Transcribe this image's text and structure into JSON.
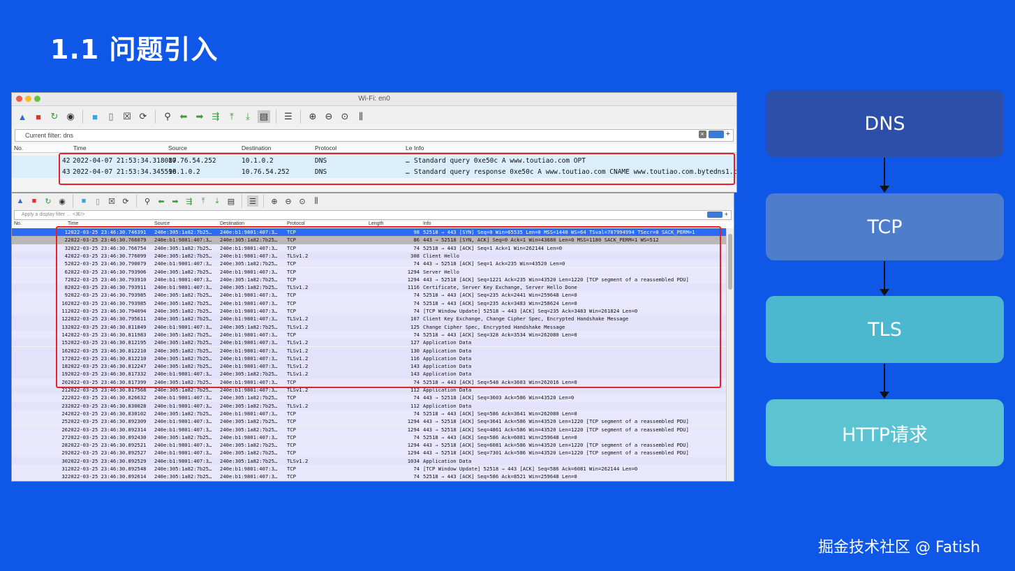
{
  "slide": {
    "title": "1.1 问题引入"
  },
  "top_window": {
    "title": "Wi-Fi: en0",
    "filter_label": "Current filter: dns",
    "columns": [
      "No.",
      "Time",
      "Source",
      "Destination",
      "Protocol",
      "Le",
      "Info"
    ],
    "rows": [
      {
        "no": "42",
        "time": "2022-04-07 21:53:34.318087",
        "source": "10.76.54.252",
        "destination": "10.1.0.2",
        "protocol": "DNS",
        "len": "…",
        "info": "Standard query 0xe50c A www.toutiao.com OPT"
      },
      {
        "no": "43",
        "time": "2022-04-07 21:53:34.345596",
        "source": "10.1.0.2",
        "destination": "10.76.54.252",
        "protocol": "DNS",
        "len": "…",
        "info": "Standard query response 0xe50c A www.toutiao.com CNAME www.toutiao.com.bytedns1.com CNAME ww"
      }
    ]
  },
  "bottom_window": {
    "filter_placeholder": "Apply a display filter … <⌘/>",
    "columns": [
      "No.",
      "Time",
      "Source",
      "Destination",
      "Protocol",
      "Length",
      "Info"
    ],
    "rows": [
      {
        "no": "1",
        "time": "2022-03-25 23:46:30.746391",
        "src": "240e:305:1a82:7b25…",
        "dst": "240e:b1:9801:407:3…",
        "proto": "TCP",
        "len": "98",
        "info": "52518 → 443 [SYN] Seq=0 Win=65535 Len=0 MSS=1440 WS=64 TSval=787994994 TSecr=0 SACK_PERM=1"
      },
      {
        "no": "2",
        "time": "2022-03-25 23:46:30.766079",
        "src": "240e:b1:9801:407:3…",
        "dst": "240e:305:1a82:7b25…",
        "proto": "TCP",
        "len": "86",
        "info": "443 → 52518 [SYN, ACK] Seq=0 Ack=1 Win=43680 Len=0 MSS=1180 SACK_PERM=1 WS=512"
      },
      {
        "no": "3",
        "time": "2022-03-25 23:46:30.766754",
        "src": "240e:305:1a82:7b25…",
        "dst": "240e:b1:9801:407:3…",
        "proto": "TCP",
        "len": "74",
        "info": "52518 → 443 [ACK] Seq=1 Ack=1 Win=262144 Len=0"
      },
      {
        "no": "4",
        "time": "2022-03-25 23:46:30.776099",
        "src": "240e:305:1a82:7b25…",
        "dst": "240e:b1:9801:407:3…",
        "proto": "TLSv1.2",
        "len": "308",
        "info": "Client Hello"
      },
      {
        "no": "5",
        "time": "2022-03-25 23:46:30.790079",
        "src": "240e:b1:9801:407:3…",
        "dst": "240e:305:1a82:7b25…",
        "proto": "TCP",
        "len": "74",
        "info": "443 → 52518 [ACK] Seq=1 Ack=235 Win=43520 Len=0"
      },
      {
        "no": "6",
        "time": "2022-03-25 23:46:30.793906",
        "src": "240e:305:1a82:7b25…",
        "dst": "240e:b1:9801:407:3…",
        "proto": "TCP",
        "len": "1294",
        "info": "Server Hello"
      },
      {
        "no": "7",
        "time": "2022-03-25 23:46:30.793910",
        "src": "240e:b1:9801:407:3…",
        "dst": "240e:305:1a82:7b25…",
        "proto": "TCP",
        "len": "1294",
        "info": "443 → 52518 [ACK] Seq=1221 Ack=235 Win=43520 Len=1220 [TCP segment of a reassembled PDU]"
      },
      {
        "no": "8",
        "time": "2022-03-25 23:46:30.793911",
        "src": "240e:b1:9801:407:3…",
        "dst": "240e:305:1a82:7b25…",
        "proto": "TLSv1.2",
        "len": "1116",
        "info": "Certificate, Server Key Exchange, Server Hello Done"
      },
      {
        "no": "9",
        "time": "2022-03-25 23:46:30.793985",
        "src": "240e:305:1a82:7b25…",
        "dst": "240e:b1:9801:407:3…",
        "proto": "TCP",
        "len": "74",
        "info": "52518 → 443 [ACK] Seq=235 Ack=2441 Win=259648 Len=0"
      },
      {
        "no": "10",
        "time": "2022-03-25 23:46:30.793985",
        "src": "240e:305:1a82:7b25…",
        "dst": "240e:b1:9801:407:3…",
        "proto": "TCP",
        "len": "74",
        "info": "52518 → 443 [ACK] Seq=235 Ack=3483 Win=258624 Len=0"
      },
      {
        "no": "11",
        "time": "2022-03-25 23:46:30.794094",
        "src": "240e:305:1a82:7b25…",
        "dst": "240e:b1:9801:407:3…",
        "proto": "TCP",
        "len": "74",
        "info": "[TCP Window Update] 52518 → 443 [ACK] Seq=235 Ack=3483 Win=261824 Len=0"
      },
      {
        "no": "12",
        "time": "2022-03-25 23:46:30.795611",
        "src": "240e:305:1a82:7b25…",
        "dst": "240e:b1:9801:407:3…",
        "proto": "TLSv1.2",
        "len": "167",
        "info": "Client Key Exchange, Change Cipher Spec, Encrypted Handshake Message"
      },
      {
        "no": "13",
        "time": "2022-03-25 23:46:30.811849",
        "src": "240e:b1:9801:407:3…",
        "dst": "240e:305:1a82:7b25…",
        "proto": "TLSv1.2",
        "len": "125",
        "info": "Change Cipher Spec, Encrypted Handshake Message"
      },
      {
        "no": "14",
        "time": "2022-03-25 23:46:30.811983",
        "src": "240e:305:1a82:7b25…",
        "dst": "240e:b1:9801:407:3…",
        "proto": "TCP",
        "len": "74",
        "info": "52518 → 443 [ACK] Seq=328 Ack=3534 Win=262080 Len=0"
      },
      {
        "no": "15",
        "time": "2022-03-25 23:46:30.812195",
        "src": "240e:305:1a82:7b25…",
        "dst": "240e:b1:9801:407:3…",
        "proto": "TLSv1.2",
        "len": "127",
        "info": "Application Data"
      },
      {
        "no": "16",
        "time": "2022-03-25 23:46:30.812210",
        "src": "240e:305:1a82:7b25…",
        "dst": "240e:b1:9801:407:3…",
        "proto": "TLSv1.2",
        "len": "130",
        "info": "Application Data"
      },
      {
        "no": "17",
        "time": "2022-03-25 23:46:30.812210",
        "src": "240e:305:1a82:7b25…",
        "dst": "240e:b1:9801:407:3…",
        "proto": "TLSv1.2",
        "len": "116",
        "info": "Application Data"
      },
      {
        "no": "18",
        "time": "2022-03-25 23:46:30.812247",
        "src": "240e:305:1a82:7b25…",
        "dst": "240e:b1:9801:407:3…",
        "proto": "TLSv1.2",
        "len": "143",
        "info": "Application Data"
      },
      {
        "no": "19",
        "time": "2022-03-25 23:46:30.817332",
        "src": "240e:b1:9801:407:3…",
        "dst": "240e:305:1a82:7b25…",
        "proto": "TLSv1.2",
        "len": "143",
        "info": "Application Data"
      },
      {
        "no": "20",
        "time": "2022-03-25 23:46:30.817399",
        "src": "240e:305:1a82:7b25…",
        "dst": "240e:b1:9801:407:3…",
        "proto": "TCP",
        "len": "74",
        "info": "52518 → 443 [ACK] Seq=548 Ack=3603 Win=262016 Len=0"
      },
      {
        "no": "21",
        "time": "2022-03-25 23:46:30.817568",
        "src": "240e:305:1a82:7b25…",
        "dst": "240e:b1:9801:407:3…",
        "proto": "TLSv1.2",
        "len": "112",
        "info": "Application Data"
      },
      {
        "no": "22",
        "time": "2022-03-25 23:46:30.826632",
        "src": "240e:b1:9801:407:3…",
        "dst": "240e:305:1a82:7b25…",
        "proto": "TCP",
        "len": "74",
        "info": "443 → 52518 [ACK] Seq=3603 Ack=586 Win=43520 Len=0"
      },
      {
        "no": "23",
        "time": "2022-03-25 23:46:30.830028",
        "src": "240e:b1:9801:407:3…",
        "dst": "240e:305:1a82:7b25…",
        "proto": "TLSv1.2",
        "len": "112",
        "info": "Application Data"
      },
      {
        "no": "24",
        "time": "2022-03-25 23:46:30.830102",
        "src": "240e:305:1a82:7b25…",
        "dst": "240e:b1:9801:407:3…",
        "proto": "TCP",
        "len": "74",
        "info": "52518 → 443 [ACK] Seq=586 Ack=3641 Win=262080 Len=0"
      },
      {
        "no": "25",
        "time": "2022-03-25 23:46:30.892309",
        "src": "240e:b1:9801:407:3…",
        "dst": "240e:305:1a82:7b25…",
        "proto": "TCP",
        "len": "1294",
        "info": "443 → 52518 [ACK] Seq=3641 Ack=586 Win=43520 Len=1220 [TCP segment of a reassembled PDU]"
      },
      {
        "no": "26",
        "time": "2022-03-25 23:46:30.892314",
        "src": "240e:b1:9801:407:3…",
        "dst": "240e:305:1a82:7b25…",
        "proto": "TCP",
        "len": "1294",
        "info": "443 → 52518 [ACK] Seq=4861 Ack=586 Win=43520 Len=1220 [TCP segment of a reassembled PDU]"
      },
      {
        "no": "27",
        "time": "2022-03-25 23:46:30.892430",
        "src": "240e:305:1a82:7b25…",
        "dst": "240e:b1:9801:407:3…",
        "proto": "TCP",
        "len": "74",
        "info": "52518 → 443 [ACK] Seq=586 Ack=6081 Win=259648 Len=0"
      },
      {
        "no": "28",
        "time": "2022-03-25 23:46:30.892521",
        "src": "240e:b1:9801:407:3…",
        "dst": "240e:305:1a82:7b25…",
        "proto": "TCP",
        "len": "1294",
        "info": "443 → 52518 [ACK] Seq=6081 Ack=586 Win=43520 Len=1220 [TCP segment of a reassembled PDU]"
      },
      {
        "no": "29",
        "time": "2022-03-25 23:46:30.892527",
        "src": "240e:b1:9801:407:3…",
        "dst": "240e:305:1a82:7b25…",
        "proto": "TCP",
        "len": "1294",
        "info": "443 → 52518 [ACK] Seq=7301 Ack=586 Win=43520 Len=1220 [TCP segment of a reassembled PDU]"
      },
      {
        "no": "30",
        "time": "2022-03-25 23:46:30.892529",
        "src": "240e:b1:9801:407:3…",
        "dst": "240e:305:1a82:7b25…",
        "proto": "TLSv1.2",
        "len": "1034",
        "info": "Application Data"
      },
      {
        "no": "31",
        "time": "2022-03-25 23:46:30.892548",
        "src": "240e:305:1a82:7b25…",
        "dst": "240e:b1:9801:407:3…",
        "proto": "TCP",
        "len": "74",
        "info": "[TCP Window Update] 52518 → 443 [ACK] Seq=586 Ack=6081 Win=262144 Len=0"
      },
      {
        "no": "32",
        "time": "2022-03-25 23:46:30.892614",
        "src": "240e:305:1a82:7b25…",
        "dst": "240e:b1:9801:407:3…",
        "proto": "TCP",
        "len": "74",
        "info": "52518 → 443 [ACK] Seq=586 Ack=8521 Win=259648 Len=0"
      }
    ]
  },
  "flow": {
    "steps": [
      "DNS",
      "TCP",
      "TLS",
      "HTTP请求"
    ]
  },
  "watermark": "掘金技术社区 @ Fatish",
  "colors": {
    "background": "#0f57e6",
    "highlight": "#e8202a",
    "dns": "#2c4fa9",
    "tcp": "#4d7dcb",
    "tls": "#4cb8cf",
    "http": "#5cc3d2"
  }
}
